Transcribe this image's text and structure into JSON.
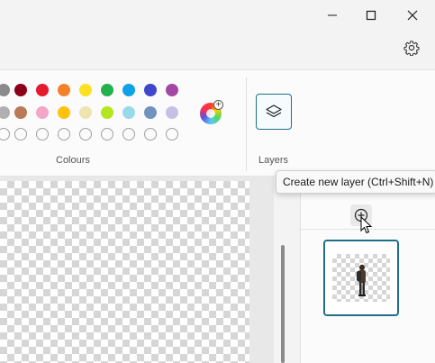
{
  "window": {
    "minimize_icon": "minimize-icon",
    "maximize_icon": "maximize-icon",
    "close_icon": "close-icon"
  },
  "toolbar": {
    "settings_icon": "gear-icon"
  },
  "colours": {
    "label": "Colours",
    "row1": [
      "#8a8a8a",
      "#8b0016",
      "#e51a2e",
      "#f5802a",
      "#fde022",
      "#22b14c",
      "#0ea1e8",
      "#3f48cc",
      "#a349a4"
    ],
    "row2": [
      "#b0b0b0",
      "#b97a57",
      "#f4a6c8",
      "#ffc20e",
      "#efe4b0",
      "#b5e61d",
      "#99d9ea",
      "#7092be",
      "#c8bfe7"
    ],
    "row3_empty_count": 9,
    "edit_colours_icon": "colour-wheel-icon"
  },
  "layers": {
    "label": "Layers",
    "button_icon": "layers-icon",
    "add_layer_icon": "add-circle-icon",
    "tooltip": "Create new layer (Ctrl+Shift+N)"
  }
}
